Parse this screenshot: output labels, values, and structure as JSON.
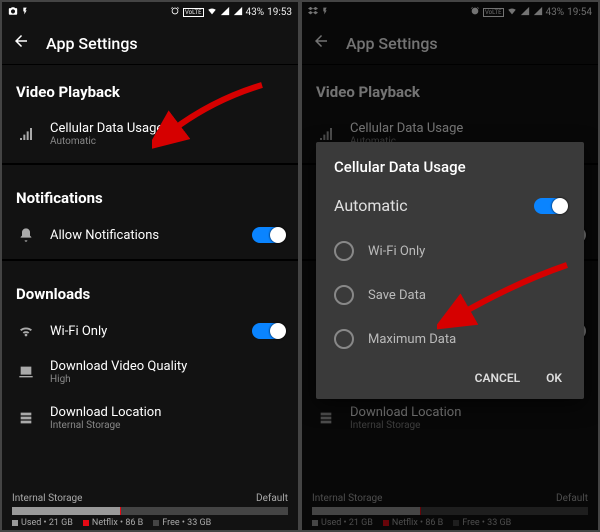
{
  "status": {
    "battery": "43%",
    "time_left": "19:53",
    "time_right": "19:54",
    "volte": "VoLTE"
  },
  "header": {
    "title": "App Settings"
  },
  "video": {
    "section": "Video Playback",
    "cell_label": "Cellular Data Usage",
    "cell_sub": "Automatic"
  },
  "notif": {
    "section": "Notifications",
    "allow": "Allow Notifications"
  },
  "downloads": {
    "section": "Downloads",
    "wifi": "Wi-Fi Only",
    "quality_label": "Download Video Quality",
    "quality_sub": "High",
    "location_label": "Download Location",
    "location_sub": "Internal Storage"
  },
  "storage": {
    "label": "Internal Storage",
    "default": "Default",
    "used": "Used • 21 GB",
    "netflix": "Netflix • 86 B",
    "free": "Free • 33 GB",
    "used_pct": 39,
    "netflix_pct": 0.2
  },
  "dialog": {
    "title": "Cellular Data Usage",
    "auto": "Automatic",
    "opt1": "Wi-Fi Only",
    "opt2": "Save Data",
    "opt3": "Maximum Data",
    "cancel": "CANCEL",
    "ok": "OK"
  }
}
